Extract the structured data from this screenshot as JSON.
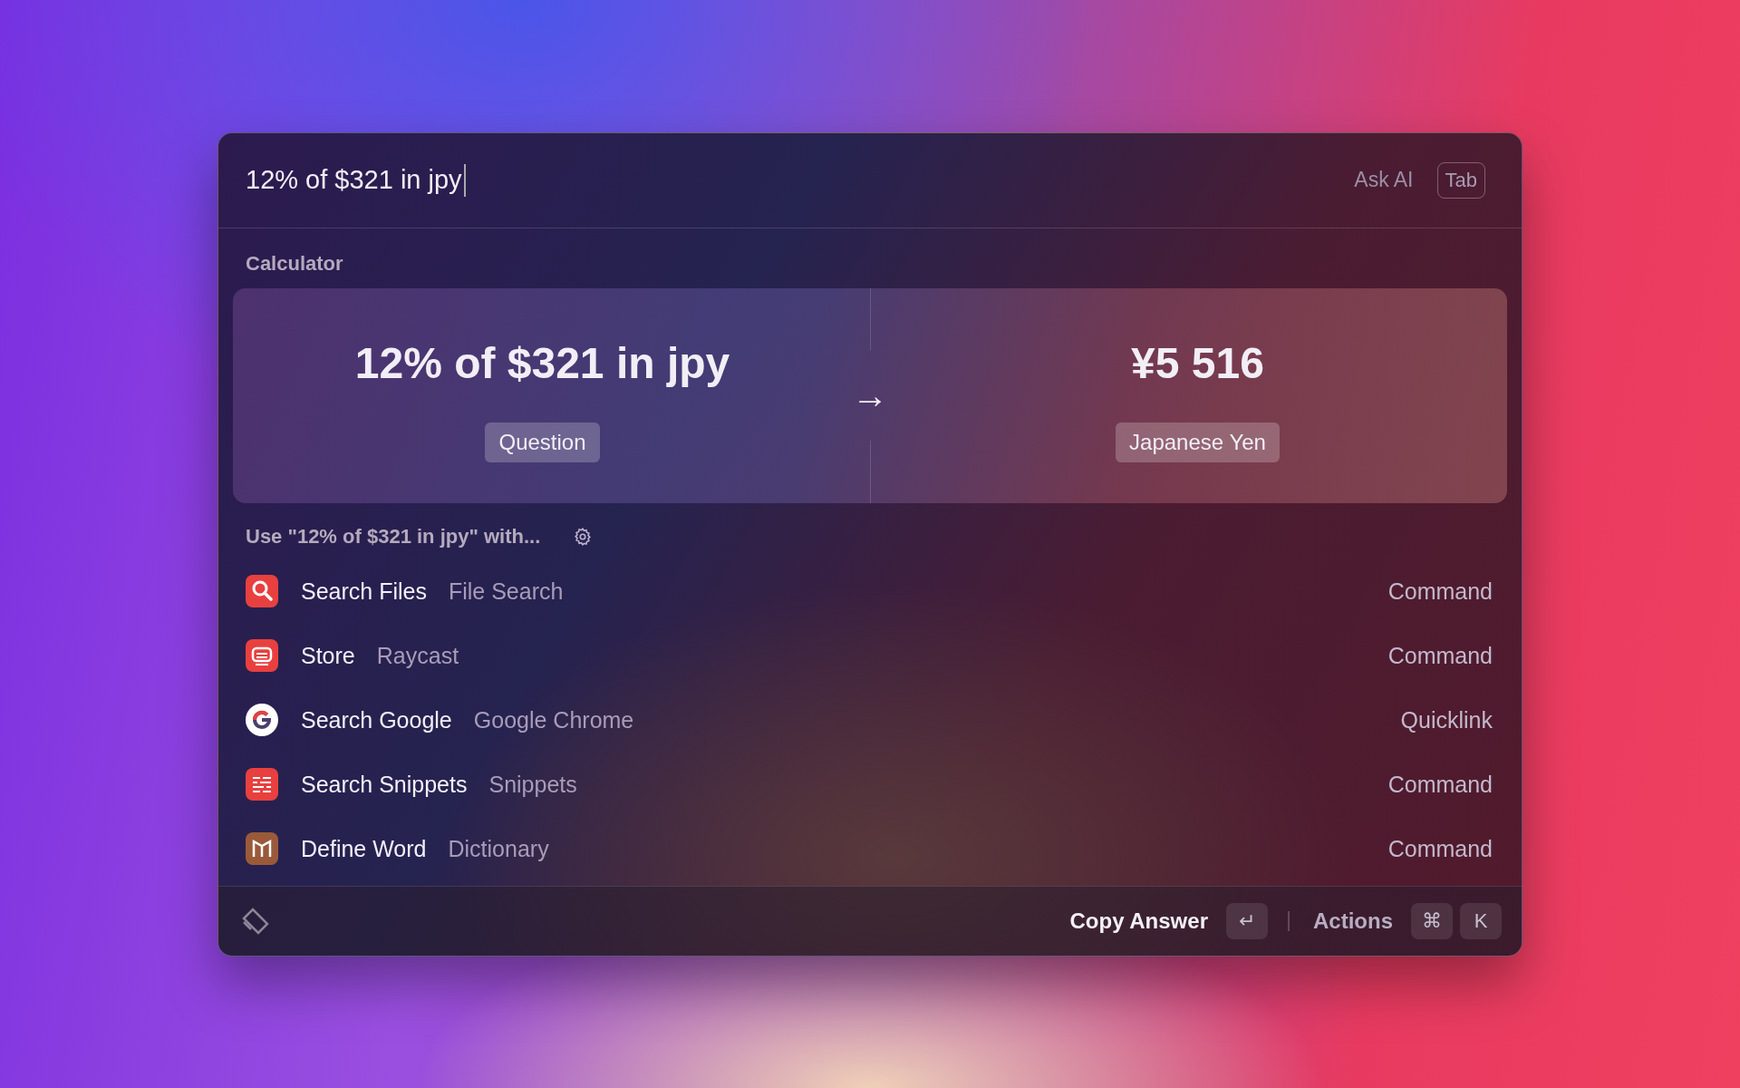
{
  "search": {
    "value": "12% of $321 in jpy",
    "ask_ai": "Ask AI",
    "ask_ai_key": "Tab"
  },
  "section_title": "Calculator",
  "calculator": {
    "question": "12% of $321 in jpy",
    "question_label": "Question",
    "arrow": "→",
    "answer": "¥5 516",
    "answer_label": "Japanese Yen"
  },
  "use_with": "Use \"12% of $321 in jpy\" with...",
  "results": [
    {
      "title": "Search Files",
      "subtitle": "File Search",
      "type": "Command"
    },
    {
      "title": "Store",
      "subtitle": "Raycast",
      "type": "Command"
    },
    {
      "title": "Search Google",
      "subtitle": "Google Chrome",
      "type": "Quicklink"
    },
    {
      "title": "Search Snippets",
      "subtitle": "Snippets",
      "type": "Command"
    },
    {
      "title": "Define Word",
      "subtitle": "Dictionary",
      "type": "Command"
    }
  ],
  "footer": {
    "primary_action": "Copy Answer",
    "primary_key": "↵",
    "actions": "Actions",
    "action_keys": [
      "⌘",
      "K"
    ]
  }
}
